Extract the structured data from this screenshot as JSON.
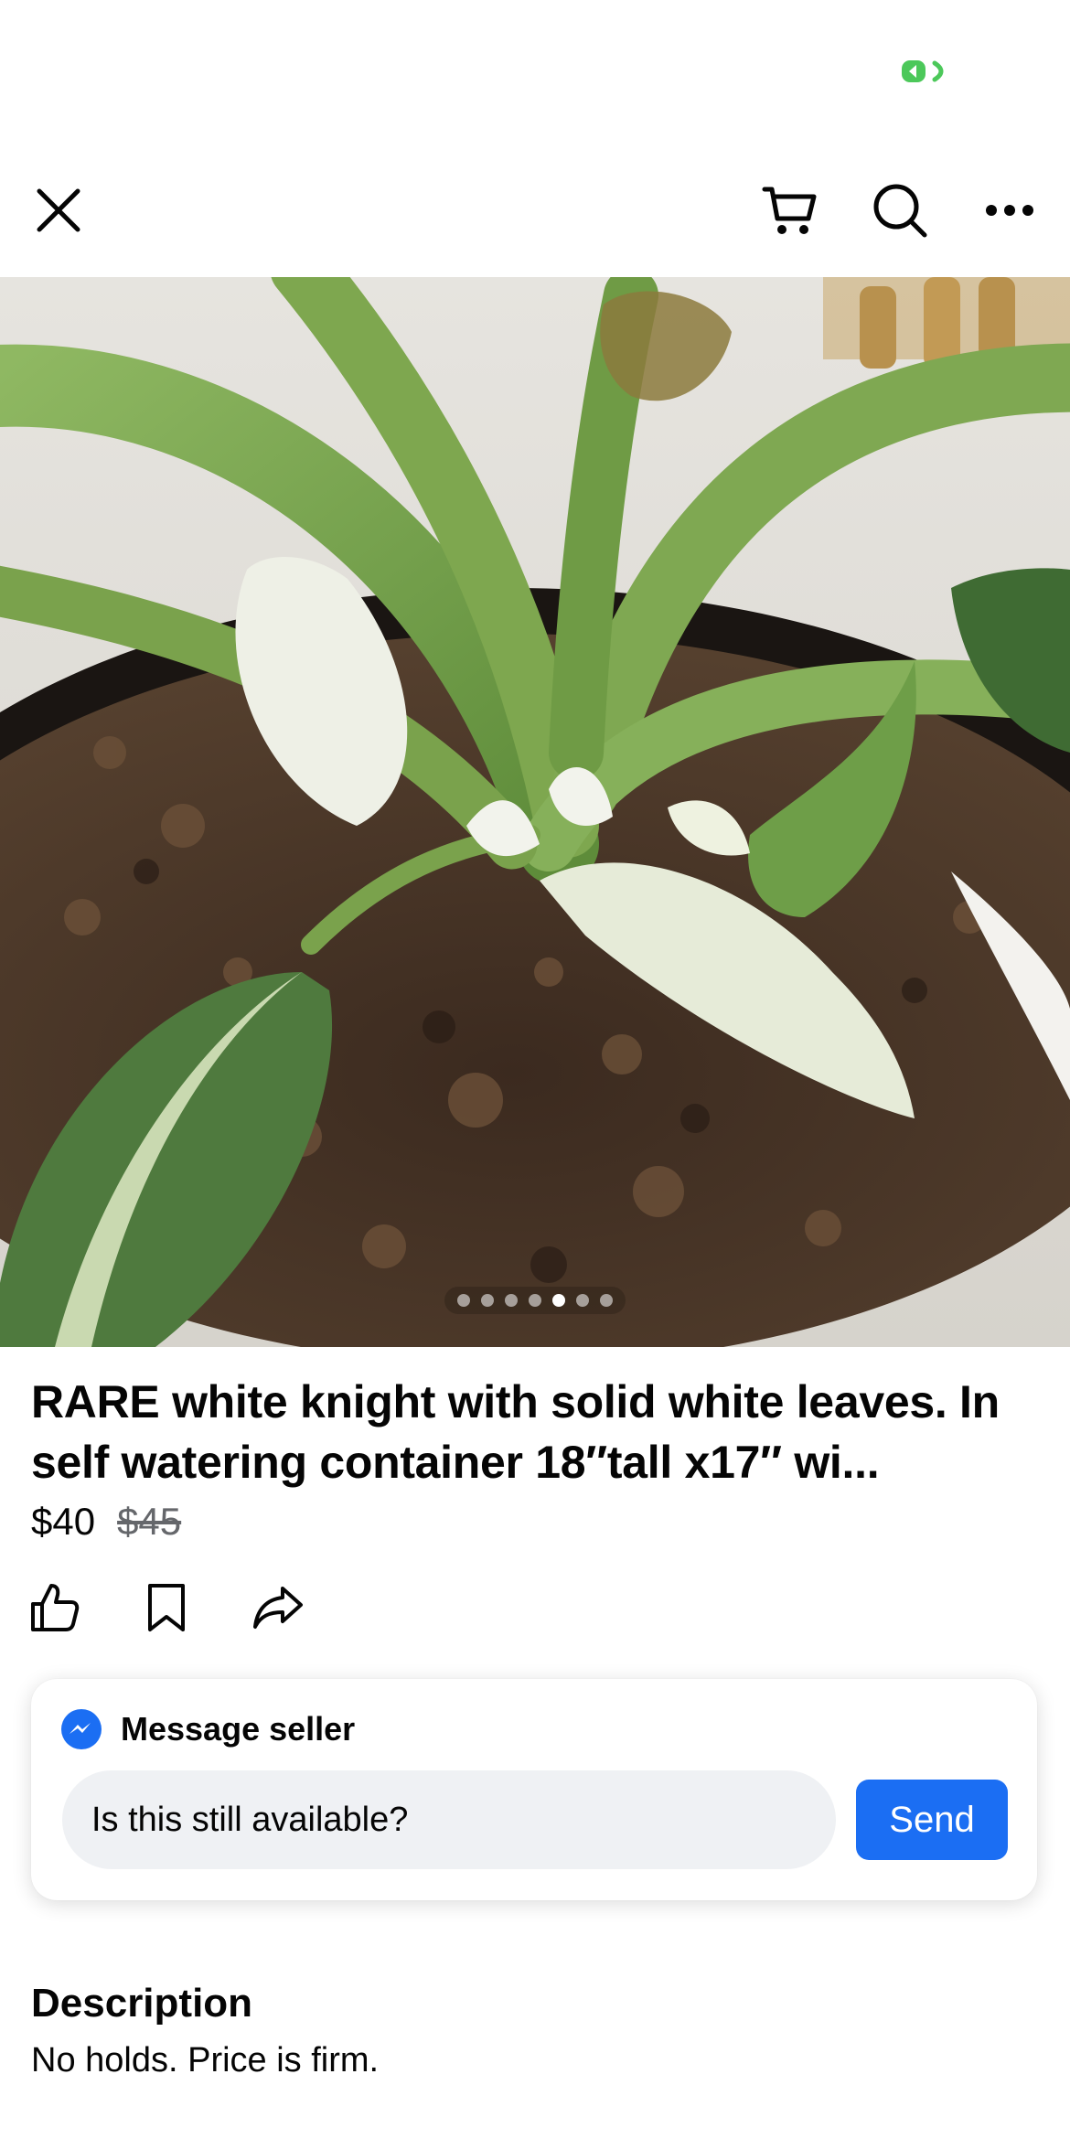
{
  "status_bar": {
    "indicator_color": "#4cc85a"
  },
  "nav": {
    "close_icon": "close-icon",
    "cart_icon": "cart-icon",
    "search_icon": "search-icon",
    "more_icon": "more-icon"
  },
  "listing": {
    "title": "RARE white knight with solid white leaves. In self watering container 18″tall x17″ wi...",
    "price": "$40",
    "original_price": "$45",
    "photo_count": 7,
    "active_photo_index": 4
  },
  "actions": {
    "like_icon": "thumbs-up-icon",
    "save_icon": "bookmark-icon",
    "share_icon": "share-icon"
  },
  "message": {
    "title": "Message seller",
    "input_value": "Is this still available?",
    "send_label": "Send",
    "messenger_color": "#1b6ef3"
  },
  "description": {
    "heading": "Description",
    "text": "No holds. Price is firm."
  }
}
